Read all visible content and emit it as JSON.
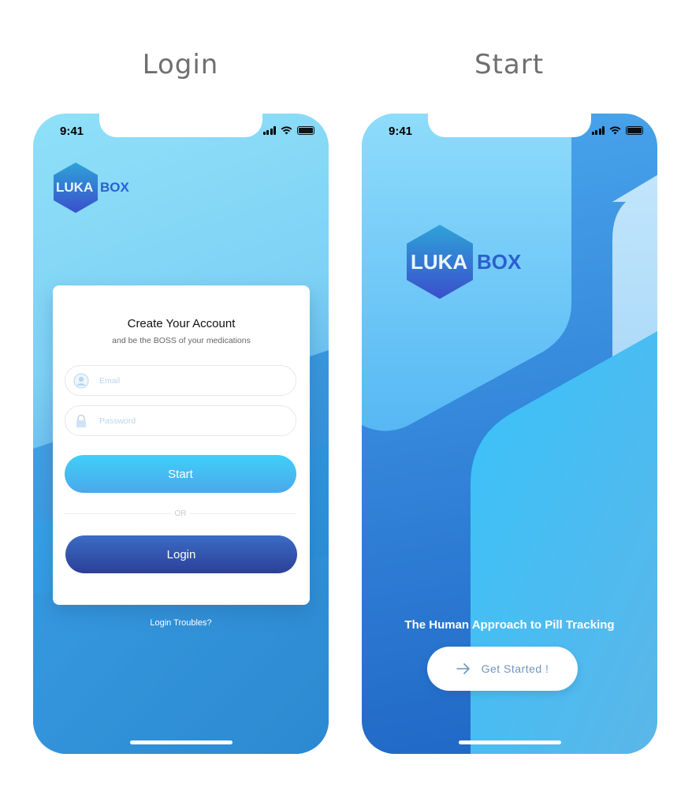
{
  "screens": {
    "login": {
      "title": "Login",
      "status_time": "9:41",
      "logo": {
        "part1": "LUKA",
        "part2": "BOX"
      },
      "card": {
        "title": "Create Your Account",
        "subtitle": "and be the BOSS of your medications",
        "email_placeholder": "Email",
        "password_placeholder": "Password",
        "start_label": "Start",
        "or_label": "OR",
        "login_label": "Login"
      },
      "login_troubles": "Login Troubles?"
    },
    "start": {
      "title": "Start",
      "status_time": "9:41",
      "logo": {
        "part1": "LUKA",
        "part2": "BOX"
      },
      "tagline": "The Human Approach to Pill Tracking",
      "cta_label": "Get Started !"
    }
  },
  "icons": {
    "status": [
      "signal-icon",
      "wifi-icon",
      "battery-icon"
    ],
    "email_field": "user-icon",
    "password_field": "lock-icon",
    "cta": "arrow-right-icon"
  },
  "colors": {
    "brand_dark": "#2b5fcf",
    "start_button": "#3fd0f8",
    "login_button": "#2c3f98",
    "placeholder": "#b9d6ee",
    "title_text": "#6f6f6f"
  }
}
